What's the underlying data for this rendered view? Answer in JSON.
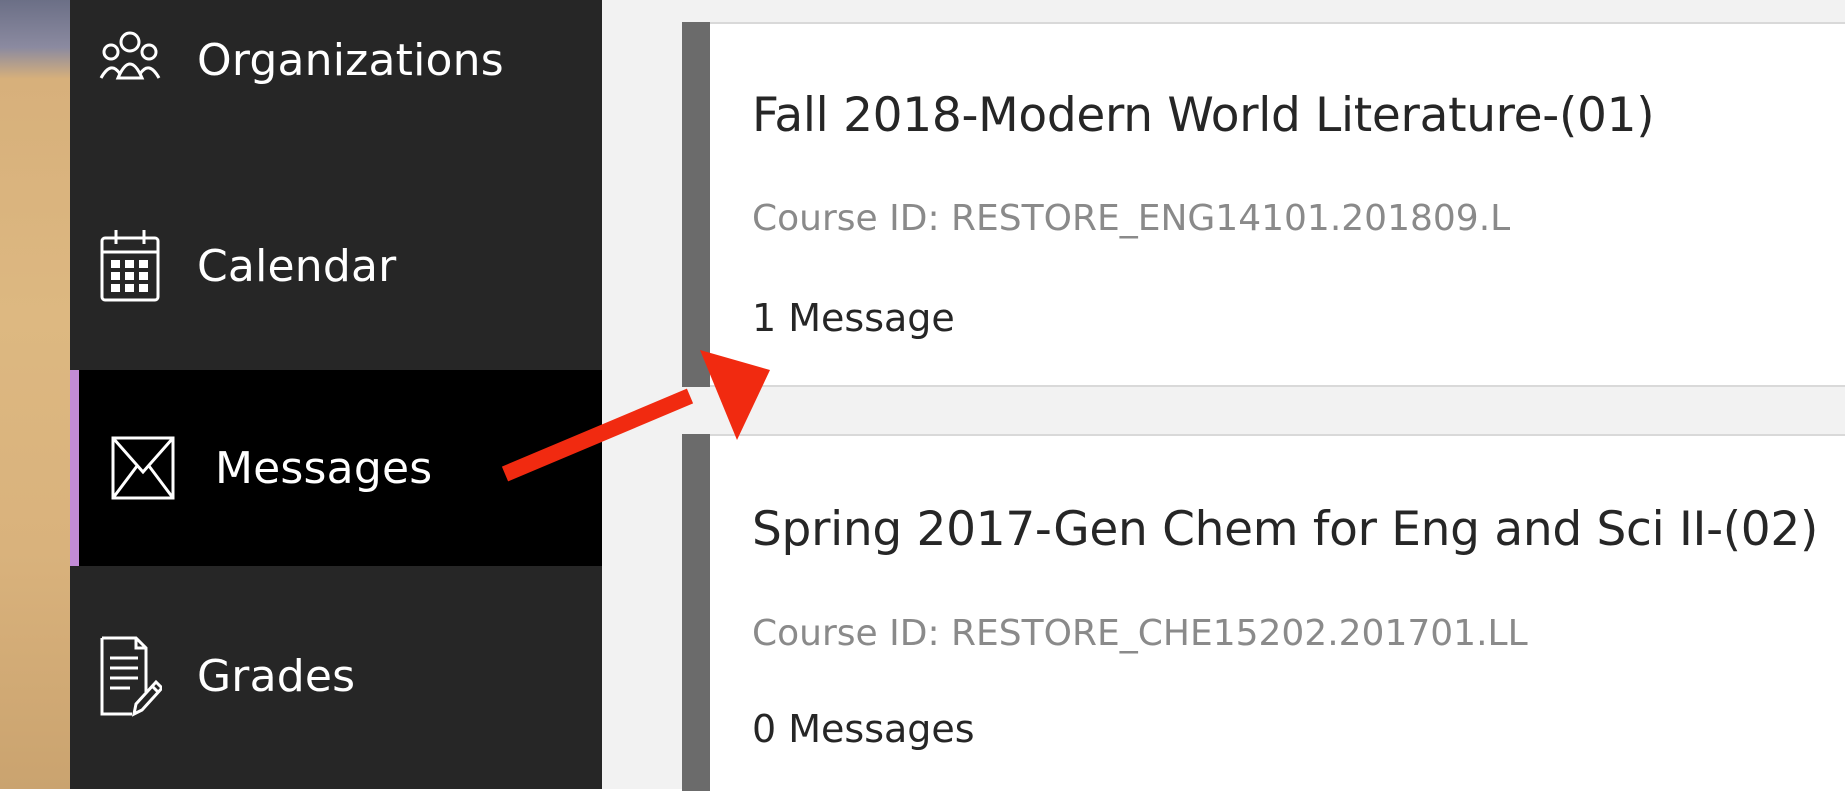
{
  "sidebar": {
    "items": [
      {
        "key": "organizations",
        "label": "Organizations",
        "icon": "people-group-icon",
        "active": false
      },
      {
        "key": "calendar",
        "label": "Calendar",
        "icon": "calendar-icon",
        "active": false
      },
      {
        "key": "messages",
        "label": "Messages",
        "icon": "envelope-icon",
        "active": true
      },
      {
        "key": "grades",
        "label": "Grades",
        "icon": "grades-document-icon",
        "active": false
      }
    ]
  },
  "courses": [
    {
      "title": "Fall 2018-Modern World Literature-(01)",
      "course_id": "Course ID: RESTORE_ENG14101.201809.L",
      "messages": "1 Message"
    },
    {
      "title": "Spring 2017-Gen Chem for Eng and Sci II-(02)",
      "course_id": "Course ID: RESTORE_CHE15202.201701.LL",
      "messages": "0 Messages"
    }
  ],
  "colors": {
    "sidebar_bg": "#262626",
    "active_bg": "#000000",
    "active_accent": "#c28bd6",
    "card_accent": "#6b6b6b",
    "annotation_arrow": "#f12a10"
  }
}
